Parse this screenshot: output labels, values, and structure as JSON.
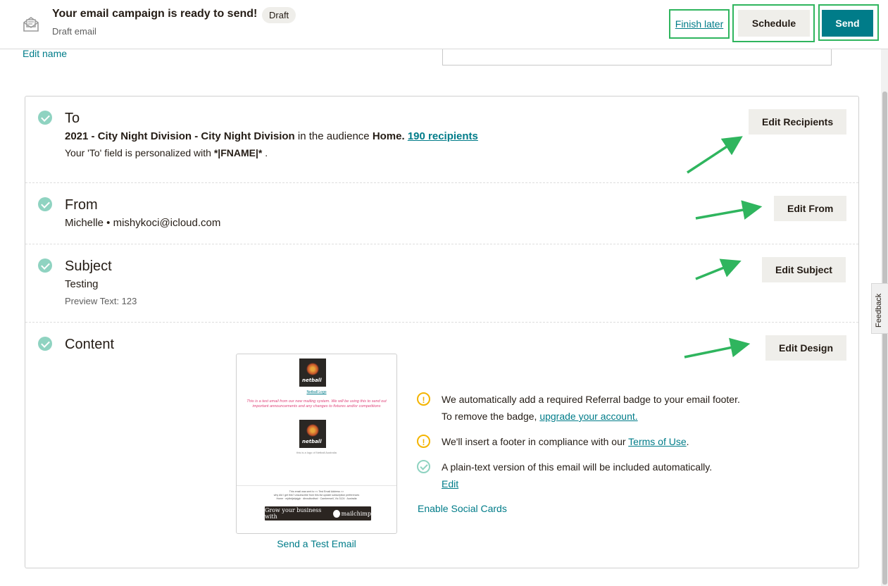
{
  "header": {
    "title": "Your email campaign is ready to send!",
    "badge": "Draft",
    "subtitle": "Draft email",
    "finish_later": "Finish later",
    "schedule": "Schedule",
    "send": "Send",
    "icon": "email-draft-icon"
  },
  "edit_name": "Edit name",
  "feedback_tab": "Feedback",
  "sections": {
    "to": {
      "title": "To",
      "segment": "2021 - City Night Division - City Night Division",
      "in_audience_text": "in the audience",
      "audience": "Home.",
      "recipients": "190 recipients",
      "personalization_prefix": "Your 'To' field is personalized with",
      "merge_tag": "*|FNAME|*",
      "personalization_suffix": ".",
      "button": "Edit Recipients"
    },
    "from": {
      "title": "From",
      "value": "Michelle • mishykoci@icloud.com",
      "button": "Edit From"
    },
    "subject": {
      "title": "Subject",
      "value": "Testing",
      "preview_text": "Preview Text: 123",
      "button": "Edit Subject"
    },
    "content": {
      "title": "Content",
      "button": "Edit Design",
      "send_test": "Send a Test Email",
      "enable_social": "Enable Social Cards",
      "preview": {
        "logo_text": "netball",
        "logo_caption": "Netball Logo",
        "body": "This is a test email from our new mailing system.  We will be using this to send out important announcements and any changes to fixtures and/or competitions",
        "image_caption": "this is a logo of Netball Australia",
        "footer_line1": "This email was sent to << Test Email Address >>",
        "footer_line2": "why did I get this?   unsubscribe from this list   update subscription preferences",
        "footer_line3": "Home · mjdbdjsbjsjgb · dbvsdbvdbvd · Camberwell, Vic 3124 · Australia",
        "mailchimp_badge": "Grow your business with",
        "mailchimp_brand": "mailchimp"
      },
      "notices": [
        {
          "type": "warning",
          "text": "We automatically add a required Referral badge to your email footer. To remove the badge,",
          "link": "upgrade your account."
        },
        {
          "type": "warning",
          "text": "We'll insert a footer in compliance with our",
          "link": "Terms of Use",
          "suffix": "."
        },
        {
          "type": "success",
          "text": "A plain-text version of this email will be included automatically.",
          "link": "Edit"
        }
      ]
    }
  },
  "colors": {
    "accent": "#007c89",
    "highlight_green": "#2fb55e",
    "check": "#8fd3c1",
    "warning": "#f4b400",
    "button_gray": "#efeeea"
  }
}
